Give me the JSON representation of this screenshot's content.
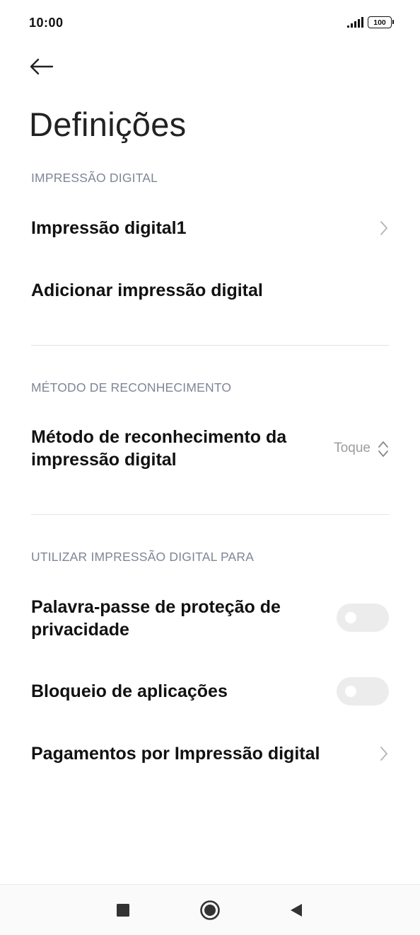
{
  "status_bar": {
    "time": "10:00",
    "battery": "100"
  },
  "header": {
    "back_icon": "arrow-left-icon",
    "title": "Definições"
  },
  "sections": {
    "fingerprint": {
      "header": "IMPRESSÃO DIGITAL",
      "items": [
        {
          "label": "Impressão digital1",
          "icon": "chevron-right-icon"
        },
        {
          "label": "Adicionar impressão digital"
        }
      ]
    },
    "method": {
      "header": "MÉTODO DE RECONHECIMENTO",
      "item": {
        "label_line1": "Método de reconhecimento da",
        "label_line2": "impressão digital",
        "value": "Toque",
        "icon": "chevron-up-down-icon"
      }
    },
    "use_for": {
      "header": "UTILIZAR IMPRESSÃO DIGITAL PARA",
      "items": [
        {
          "label_line1": "Palavra-passe de proteção de",
          "label_line2": "privacidade",
          "toggle": false
        },
        {
          "label": "Bloqueio de aplicações",
          "toggle": false
        },
        {
          "label": "Pagamentos por Impressão digital",
          "icon": "chevron-right-icon"
        }
      ]
    }
  },
  "nav_bar": {
    "recents_icon": "square-icon",
    "home_icon": "circle-home-icon",
    "back_icon": "triangle-back-icon"
  },
  "colors": {
    "section_header": "#7f8696",
    "toggle_off": "#ececec",
    "value_text": "#9c9c9c"
  }
}
